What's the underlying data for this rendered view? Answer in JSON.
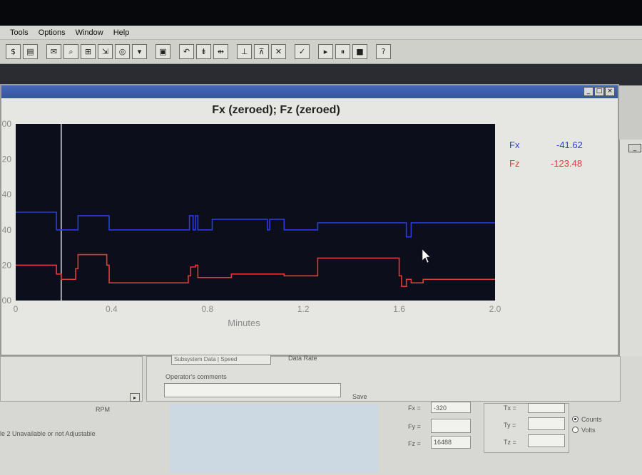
{
  "menubar": {
    "items": [
      "Tools",
      "Options",
      "Window",
      "Help"
    ]
  },
  "toolbar": {
    "icons": [
      "$",
      "▤",
      "✉",
      "⌕",
      "⊞",
      "⇲",
      "◎",
      "▾",
      "▣",
      "↶",
      "⇟",
      "⇹",
      "⊥",
      "⊼",
      "✕",
      "✓",
      "▸",
      "⏸",
      "■",
      "?"
    ]
  },
  "chart_window": {
    "title": "Fx (zeroed); Fz (zeroed)"
  },
  "chart_data": {
    "type": "line",
    "title": "Fx (zeroed); Fz (zeroed)",
    "xlabel": "Minutes",
    "ylabel": "",
    "xlim": [
      0,
      2.0
    ],
    "x_ticks": [
      "0",
      "0.4",
      "0.8",
      "1.2",
      "1.6",
      "2.0"
    ],
    "y_ticks": [
      "00",
      "20",
      "40",
      "40",
      "20",
      "00"
    ],
    "cursor_x": 0.19,
    "series": [
      {
        "name": "Fx",
        "color": "#2a3ddc",
        "x": [
          0,
          0.15,
          0.17,
          0.25,
          0.26,
          0.38,
          0.39,
          0.72,
          0.725,
          0.74,
          0.75,
          0.76,
          0.8,
          0.82,
          1.05,
          1.06,
          1.12,
          1.25,
          1.26,
          1.6,
          1.63,
          1.65,
          1.9,
          2.0
        ],
        "values": [
          50,
          50,
          40,
          40,
          48,
          48,
          40,
          40,
          48,
          40,
          48,
          40,
          40,
          46,
          40,
          46,
          40,
          40,
          44,
          44,
          36,
          44,
          44,
          44
        ]
      },
      {
        "name": "Fz",
        "color": "#e23a3a",
        "x": [
          0,
          0.15,
          0.17,
          0.19,
          0.25,
          0.26,
          0.38,
          0.39,
          0.72,
          0.73,
          0.75,
          0.76,
          0.9,
          1.12,
          1.25,
          1.26,
          1.6,
          1.61,
          1.63,
          1.65,
          1.7,
          2.0
        ],
        "values": [
          20,
          20,
          15,
          12,
          18,
          26,
          20,
          10,
          14,
          19,
          20,
          13,
          15,
          14,
          14,
          24,
          14,
          8,
          12,
          10,
          12,
          12
        ]
      }
    ]
  },
  "readouts": [
    {
      "label": "Fx",
      "value": "-41.62"
    },
    {
      "label": "Fz",
      "value": "-123.48"
    }
  ],
  "lower_panel": {
    "combo_value": "Subsystem Data  |  Speed",
    "combo_right": "Data Rate",
    "comments_label": "Operator's comments",
    "save_label": "Save",
    "rpm_label": "RPM",
    "status_text": "le 2 Unavailable or not Adjustable",
    "force_fields": [
      {
        "label": "Fx =",
        "value": "-320"
      },
      {
        "label": "Fy =",
        "value": ""
      },
      {
        "label": "Fz =",
        "value": "16488"
      }
    ],
    "torque_fields": [
      {
        "label": "Tx =",
        "value": ""
      },
      {
        "label": "Ty =",
        "value": ""
      },
      {
        "label": "Tz =",
        "value": ""
      }
    ],
    "units": [
      "Counts",
      "Volts"
    ]
  }
}
